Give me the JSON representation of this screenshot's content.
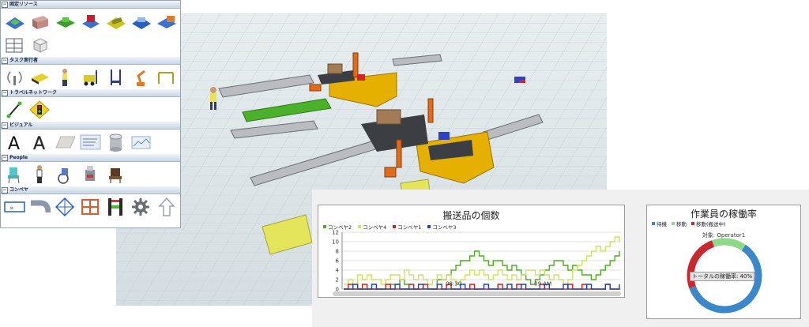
{
  "library": {
    "sections": [
      {
        "label": "固定リソース",
        "icons": [
          "source-icon",
          "queue-icon",
          "processor-icon",
          "combiner-icon",
          "separator-icon",
          "multiprocessor-icon",
          "sink-icon",
          "rack-icon",
          "basic-fixed-resource-icon"
        ]
      },
      {
        "label": "タスク実行者",
        "icons": [
          "dispatcher-icon",
          "transporter-icon",
          "operator-icon",
          "forklift-icon",
          "elevator-icon",
          "robot-icon",
          "crane-icon"
        ]
      },
      {
        "label": "トラベルネットワーク",
        "icons": [
          "network-node-icon",
          "traffic-control-icon"
        ]
      },
      {
        "label": "ビジュアル",
        "icons": [
          "text-icon",
          "text3d-icon",
          "plane-icon",
          "slide-icon",
          "shape-icon",
          "billboard-icon"
        ]
      },
      {
        "label": "People",
        "icons": [
          "chair-icon",
          "staff-icon",
          "wheelchair-icon",
          "equipment-icon",
          "waiting-chair-icon"
        ]
      },
      {
        "label": "コンベヤ",
        "icons": [
          "straight-conveyor-icon",
          "curved-conveyor-icon",
          "join-conveyor-icon",
          "decision-point-icon",
          "photo-eye-icon",
          "motor-icon",
          "transfer-icon"
        ]
      }
    ],
    "people_text": "People"
  },
  "chart1": {
    "title": "搬送品の個数",
    "legend": [
      {
        "name": "コンベヤ2",
        "color": "#4caf1f"
      },
      {
        "name": "コンベヤ4",
        "color": "#cfe06a"
      },
      {
        "name": "コンベヤ1",
        "color": "#d21f1f"
      },
      {
        "name": "コンベヤ3",
        "color": "#1f3fcf"
      }
    ]
  },
  "chart_data": [
    {
      "type": "line",
      "title": "搬送品の個数",
      "ylim": [
        0,
        12
      ],
      "y_ticks": [
        "12",
        "10",
        "8",
        "6",
        "4",
        "2",
        "0"
      ],
      "x_ticks": [
        "08:30",
        "09 AM"
      ],
      "series": [
        {
          "name": "コンベヤ2",
          "color": "#4caf1f",
          "values": [
            0,
            0,
            0,
            0,
            0,
            0,
            0,
            0,
            0,
            0,
            1,
            1,
            2,
            1,
            0,
            0,
            0,
            0,
            0,
            0,
            2,
            2,
            3,
            4,
            5,
            6,
            6,
            7,
            8,
            7,
            6,
            5,
            6,
            6,
            5,
            4,
            5,
            4,
            3,
            2,
            1,
            2,
            3,
            4,
            5,
            6,
            6,
            5,
            4,
            5,
            4,
            3,
            3,
            2,
            3,
            4,
            5,
            6,
            7,
            8
          ]
        },
        {
          "name": "コンベヤ4",
          "color": "#cfe06a",
          "values": [
            1,
            2,
            1,
            3,
            2,
            3,
            2,
            2,
            1,
            2,
            3,
            3,
            2,
            4,
            3,
            2,
            3,
            2,
            1,
            2,
            3,
            2,
            3,
            2,
            1,
            2,
            3,
            4,
            3,
            4,
            3,
            2,
            3,
            4,
            3,
            2,
            3,
            2,
            3,
            4,
            4,
            3,
            4,
            3,
            2,
            3,
            2,
            1,
            2,
            4,
            5,
            6,
            7,
            8,
            9,
            8,
            9,
            10,
            11,
            10
          ]
        },
        {
          "name": "コンベヤ1",
          "color": "#d21f1f",
          "values": [
            0,
            1,
            0,
            0,
            1,
            0,
            0,
            0,
            0,
            1,
            0,
            0,
            0,
            0,
            1,
            0,
            0,
            1,
            0,
            0,
            0,
            0,
            1,
            0,
            0,
            0,
            0,
            1,
            0,
            0,
            0,
            0,
            0,
            1,
            0,
            0,
            0,
            1,
            0,
            0,
            0,
            0,
            1,
            0,
            0,
            0,
            0,
            0,
            1,
            0,
            0,
            1,
            0,
            0,
            0,
            0,
            1,
            0,
            0,
            0
          ]
        },
        {
          "name": "コンベヤ3",
          "color": "#1f3fcf",
          "values": [
            0,
            0,
            1,
            0,
            0,
            0,
            1,
            0,
            0,
            0,
            0,
            1,
            0,
            0,
            0,
            0,
            1,
            0,
            0,
            0,
            1,
            0,
            0,
            0,
            0,
            1,
            0,
            0,
            0,
            0,
            1,
            0,
            0,
            0,
            0,
            1,
            0,
            0,
            1,
            0,
            0,
            0,
            0,
            1,
            0,
            0,
            0,
            1,
            0,
            0,
            0,
            0,
            1,
            0,
            0,
            0,
            1,
            0,
            0,
            1
          ]
        }
      ]
    },
    {
      "type": "pie",
      "title": "作業員の稼働率",
      "subtitle": "対象: Operator1",
      "center_label": "トータルの稼働率: 40%",
      "legend": [
        {
          "name": "待機",
          "color": "#3a87cc"
        },
        {
          "name": "移動",
          "color": "#8fd88a"
        },
        {
          "name": "移動(搬送中)",
          "color": "#c8282e"
        }
      ],
      "slices": [
        {
          "name": "待機",
          "value": 60,
          "color": "#3a87cc"
        },
        {
          "name": "移動(搬送中)",
          "value": 25,
          "color": "#c8282e"
        },
        {
          "name": "移動",
          "value": 15,
          "color": "#8fd88a"
        }
      ]
    }
  ]
}
